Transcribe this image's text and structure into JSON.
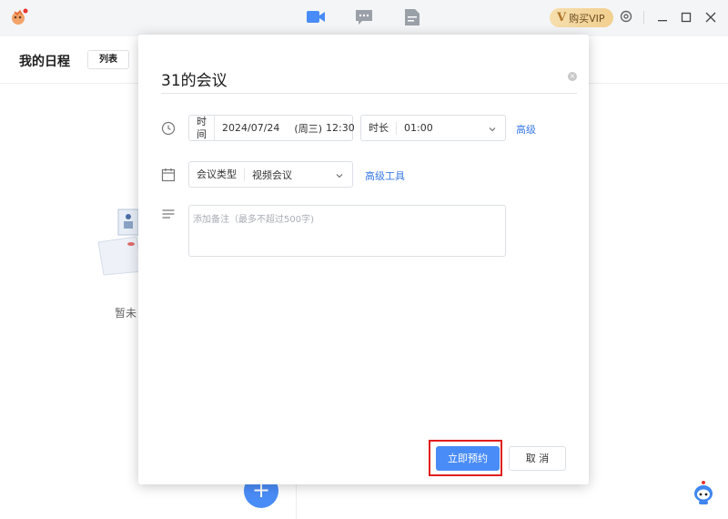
{
  "topbar": {
    "vip_badge": {
      "icon": "V",
      "label": "购买VIP"
    },
    "nav_icons": [
      "video-meeting-icon",
      "chat-icon",
      "document-icon"
    ],
    "window_controls": [
      "settings-icon",
      "minimize-icon",
      "maximize-icon",
      "close-icon"
    ],
    "accent": "#4a8cf7"
  },
  "page": {
    "title": "我的日程",
    "view_toggle": {
      "list_label": "列表"
    },
    "empty_text": "暂未",
    "add_button": "+"
  },
  "dialog": {
    "title": "31的会议",
    "time_row": {
      "time_label": "时间",
      "date": "2024/07/24",
      "weekday": "(周三)",
      "time": "12:30",
      "duration_label": "时长",
      "duration_value": "01:00",
      "advanced_link": "高级"
    },
    "type_row": {
      "type_label": "会议类型",
      "type_value": "视频会议",
      "advanced_tools_link": "高级工具"
    },
    "remark": {
      "placeholder": "添加备注（最多不超过500字)"
    },
    "buttons": {
      "confirm": "立即预约",
      "cancel": "取 消"
    },
    "highlight_color": "#e01e1e"
  }
}
